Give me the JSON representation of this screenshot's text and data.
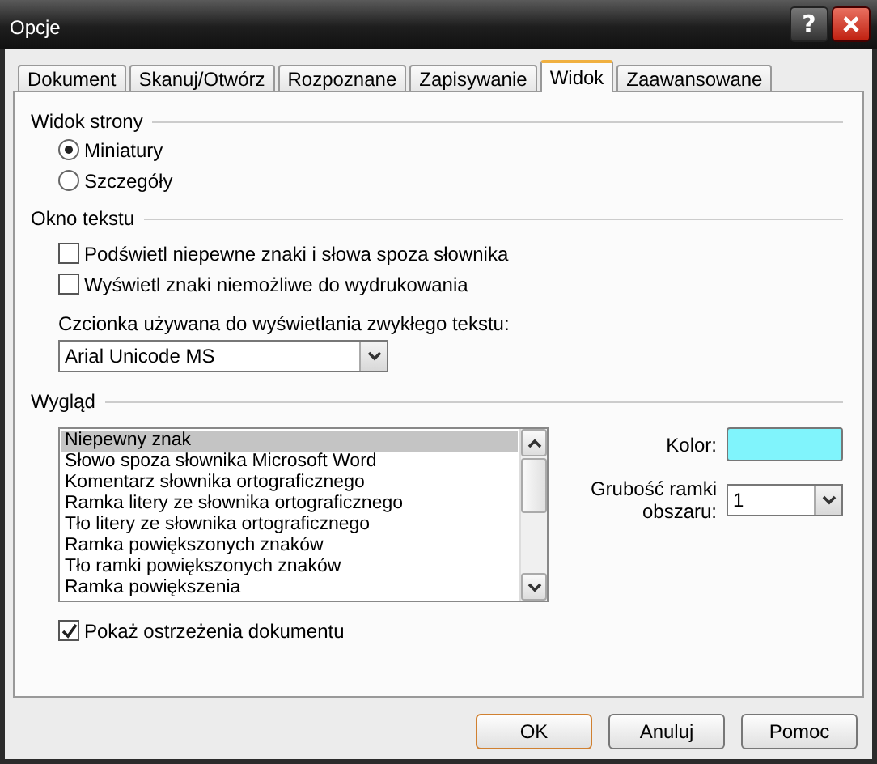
{
  "window": {
    "title": "Opcje",
    "help_button": "?"
  },
  "tabs": [
    {
      "label": "Dokument",
      "selected": false
    },
    {
      "label": "Skanuj/Otwórz",
      "selected": false
    },
    {
      "label": "Rozpoznane",
      "selected": false
    },
    {
      "label": "Zapisywanie",
      "selected": false
    },
    {
      "label": "Widok",
      "selected": true
    },
    {
      "label": "Zaawansowane",
      "selected": false
    }
  ],
  "page_view": {
    "title": "Widok strony",
    "options": [
      {
        "label": "Miniatury",
        "selected": true
      },
      {
        "label": "Szczegóły",
        "selected": false
      }
    ]
  },
  "text_window": {
    "title": "Okno tekstu",
    "checkboxes": [
      {
        "label": "Podświetl niepewne znaki i słowa spoza słownika",
        "checked": false
      },
      {
        "label": "Wyświetl znaki niemożliwe do wydrukowania",
        "checked": false
      }
    ],
    "font_label": "Czcionka używana do wyświetlania zwykłego tekstu:",
    "font_value": "Arial Unicode MS"
  },
  "appearance": {
    "title": "Wygląd",
    "items": [
      {
        "label": "Niepewny znak",
        "selected": true
      },
      {
        "label": "Słowo spoza słownika Microsoft Word",
        "selected": false
      },
      {
        "label": "Komentarz słownika ortograficznego",
        "selected": false
      },
      {
        "label": "Ramka litery ze słownika ortograficznego",
        "selected": false
      },
      {
        "label": "Tło litery ze słownika ortograficznego",
        "selected": false
      },
      {
        "label": "Ramka powiększonych znaków",
        "selected": false
      },
      {
        "label": "Tło ramki powiększonych znaków",
        "selected": false
      },
      {
        "label": "Ramka powiększenia",
        "selected": false
      }
    ],
    "color_label": "Kolor:",
    "color": "#80f4fc",
    "border_label": "Grubość ramki obszaru:",
    "border_value": "1",
    "warnings": {
      "label": "Pokaż ostrzeżenia dokumentu",
      "checked": true
    }
  },
  "buttons": [
    {
      "label": "OK",
      "default": true
    },
    {
      "label": "Anuluj",
      "default": false
    },
    {
      "label": "Pomoc",
      "default": false
    }
  ]
}
